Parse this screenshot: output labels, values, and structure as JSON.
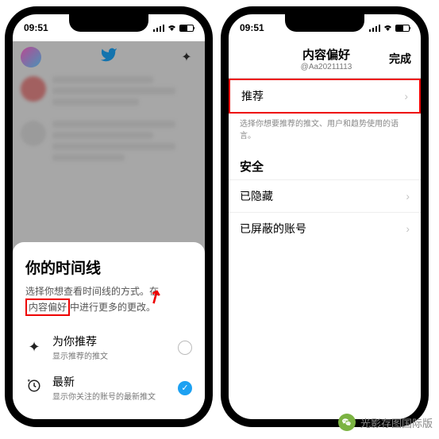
{
  "status": {
    "time": "09:51"
  },
  "phone1": {
    "sheet": {
      "title": "你的时间线",
      "desc_pre": "选择你想查看时间线的方式。在",
      "desc_highlight": "内容偏好",
      "desc_post": "中进行更多的更改。",
      "option1": {
        "title": "为你推荐",
        "sub": "显示推荐的推文"
      },
      "option2": {
        "title": "最新",
        "sub": "显示你关注的账号的最新推文"
      }
    }
  },
  "phone2": {
    "header": {
      "title": "内容偏好",
      "handle": "@Aa20211113",
      "done": "完成"
    },
    "row_recommend": "推荐",
    "hint": "选择你想要推荐的推文、用户和趋势使用的语言。",
    "section_safety": "安全",
    "row_hidden": "已隐藏",
    "row_blocked": "已屏蔽的账号"
  },
  "watermark": {
    "text": "光影存图国际版"
  }
}
